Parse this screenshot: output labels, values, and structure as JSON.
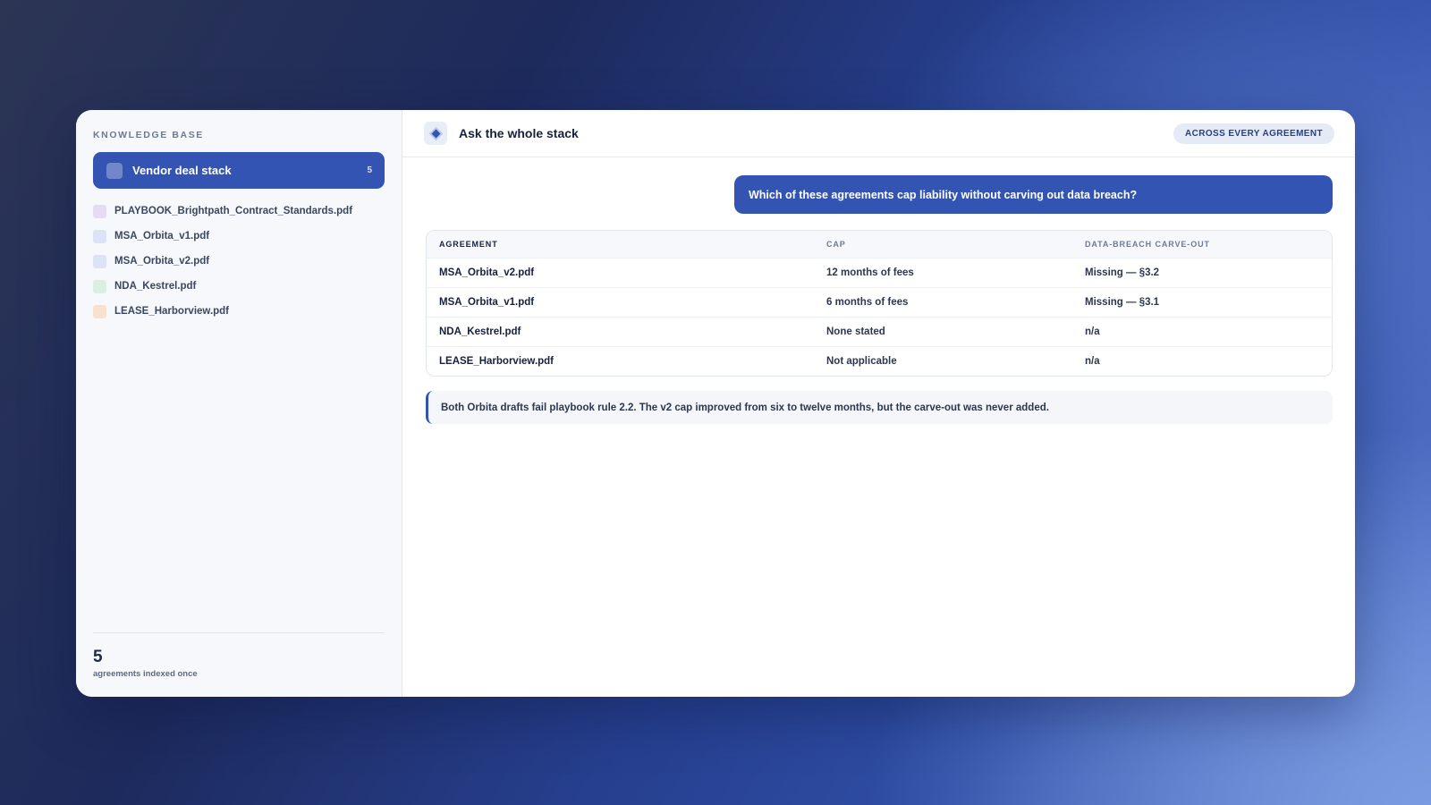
{
  "sidebar": {
    "heading": "KNOWLEDGE BASE",
    "stack": {
      "label": "Vendor deal stack",
      "count": "5"
    },
    "files": [
      {
        "name": "PLAYBOOK_Brightpath_Contract_Standards.pdf",
        "color": "#e5dcf4"
      },
      {
        "name": "MSA_Orbita_v1.pdf",
        "color": "#dbe3f4"
      },
      {
        "name": "MSA_Orbita_v2.pdf",
        "color": "#dbe3f4"
      },
      {
        "name": "NDA_Kestrel.pdf",
        "color": "#dcefe2"
      },
      {
        "name": "LEASE_Harborview.pdf",
        "color": "#f8e2cf"
      }
    ],
    "footer": {
      "number": "5",
      "label": "agreements indexed once"
    }
  },
  "header": {
    "icon": "diamond-icon",
    "title": "Ask the whole stack",
    "badge": "ACROSS EVERY AGREEMENT"
  },
  "question": "Which of these agreements cap liability without carving out data breach?",
  "table": {
    "columns": [
      "AGREEMENT",
      "CAP",
      "DATA-BREACH CARVE-OUT"
    ],
    "rows": [
      [
        "MSA_Orbita_v2.pdf",
        "12 months of fees",
        "Missing — §3.2"
      ],
      [
        "MSA_Orbita_v1.pdf",
        "6 months of fees",
        "Missing — §3.1"
      ],
      [
        "NDA_Kestrel.pdf",
        "None stated",
        "n/a"
      ],
      [
        "LEASE_Harborview.pdf",
        "Not applicable",
        "n/a"
      ]
    ]
  },
  "note": "Both Orbita drafts fail playbook rule 2.2. The v2 cap improved from six to twelve months, but the carve-out was never added.",
  "colors": {
    "accent": "#3454b4"
  }
}
